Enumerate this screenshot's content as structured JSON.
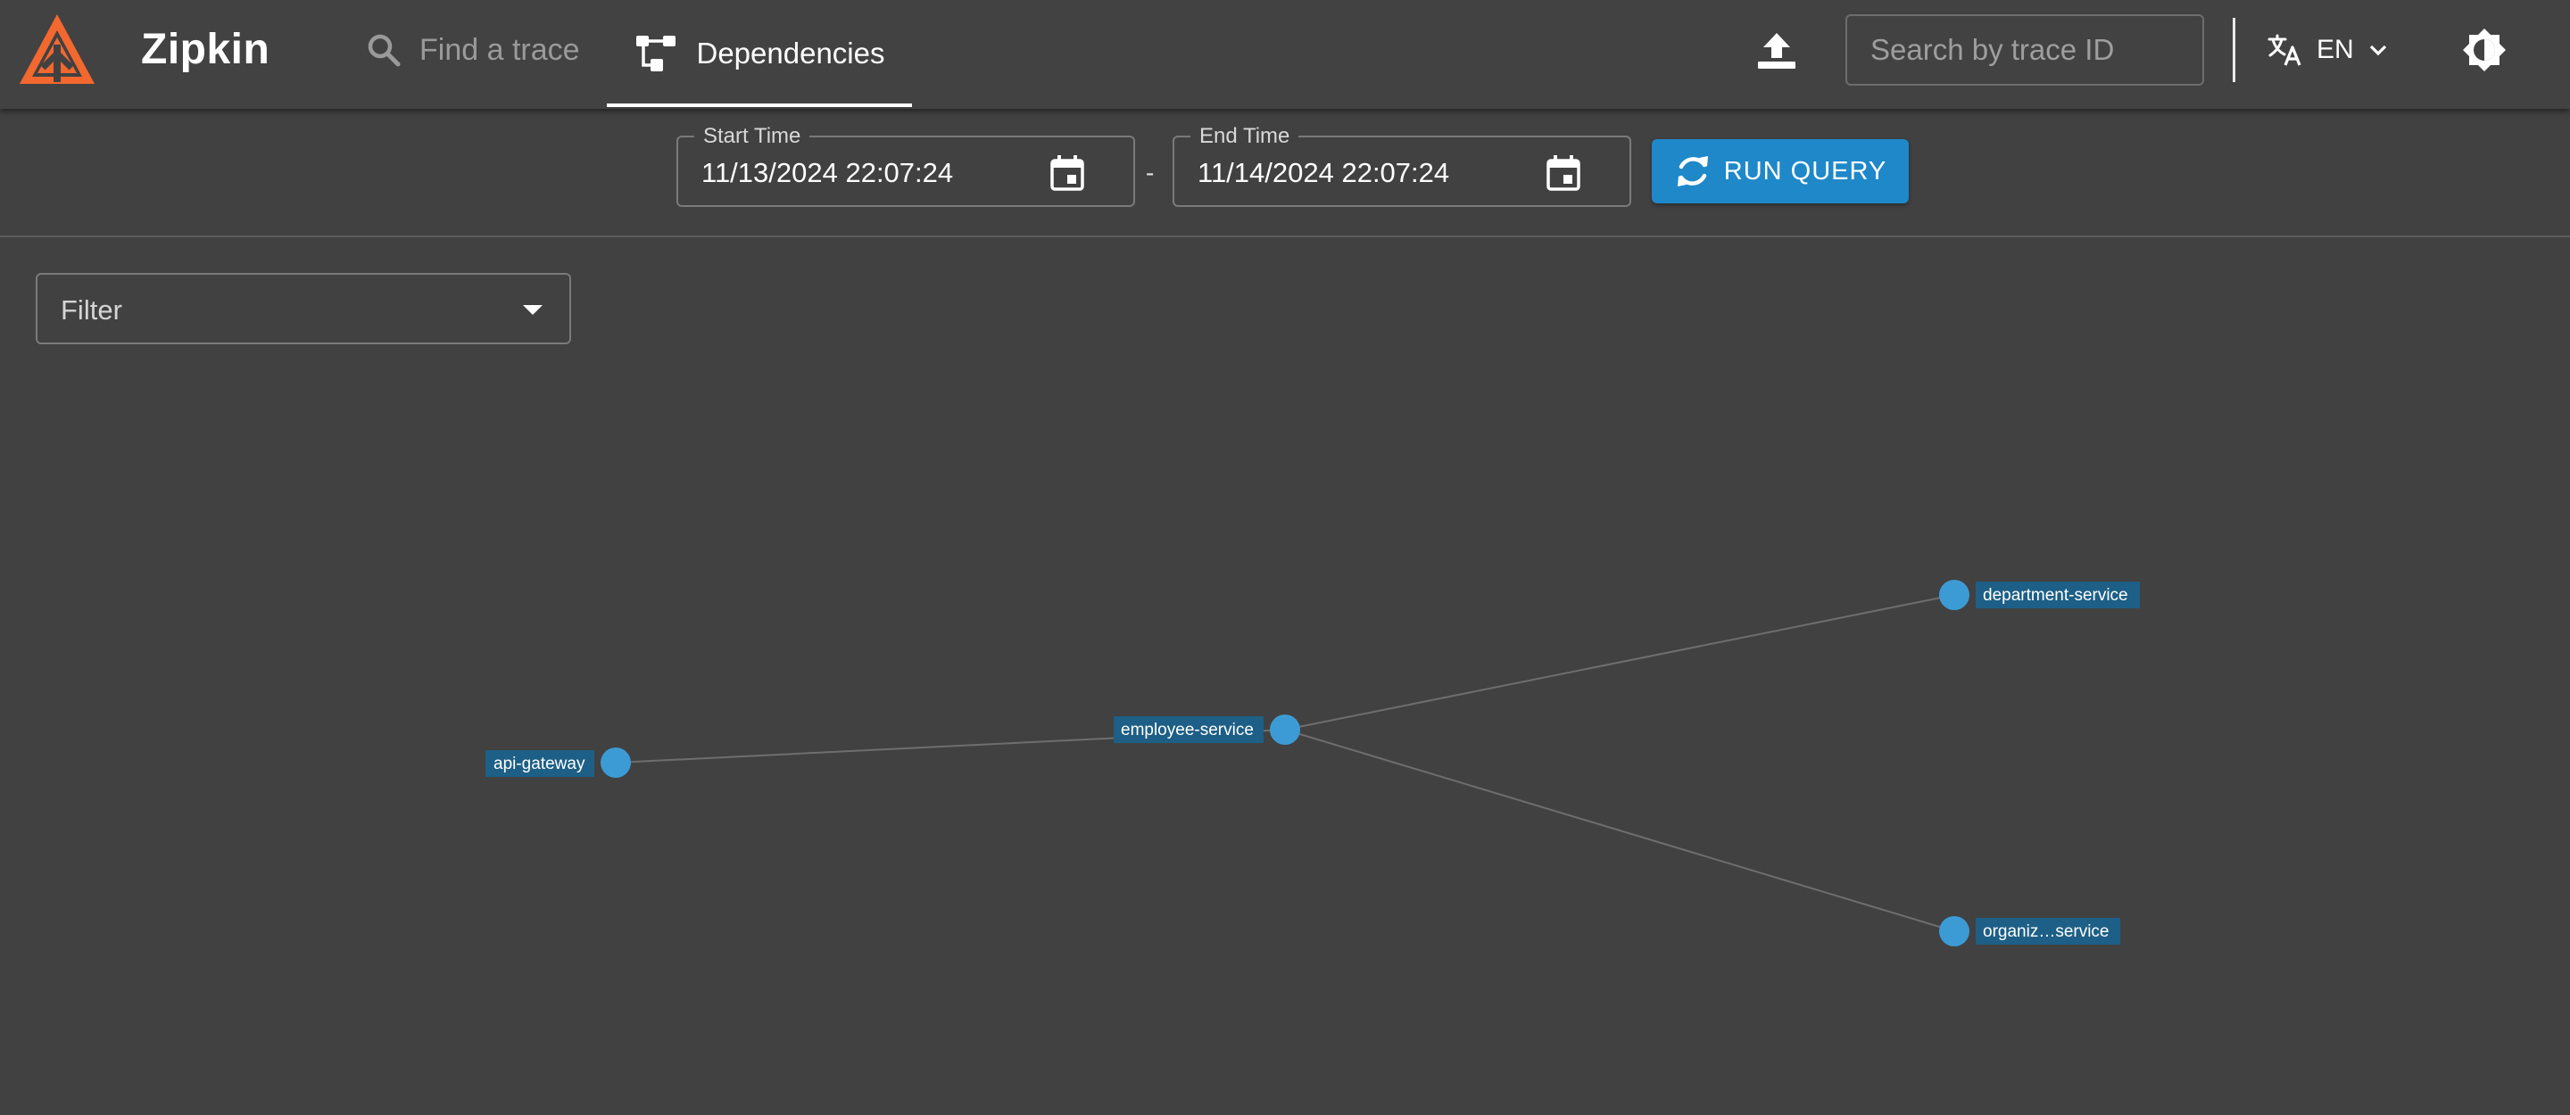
{
  "app": {
    "brand": "Zipkin"
  },
  "nav": {
    "find_trace_label": "Find a trace",
    "dependencies_label": "Dependencies"
  },
  "header": {
    "search_placeholder": "Search by trace ID",
    "language_label": "EN"
  },
  "query": {
    "start_time_label": "Start Time",
    "start_time_value": "11/13/2024 22:07:24",
    "separator": "-",
    "end_time_label": "End Time",
    "end_time_value": "11/14/2024 22:07:24",
    "run_query_label": "RUN QUERY"
  },
  "filter": {
    "placeholder": "Filter"
  },
  "dependency_graph": {
    "nodes": [
      {
        "id": "api-gateway",
        "label": "api-gateway"
      },
      {
        "id": "employee-service",
        "label": "employee-service"
      },
      {
        "id": "department-service",
        "label": "department-service"
      },
      {
        "id": "organization-service",
        "label": "organiz…service"
      }
    ],
    "edges": [
      {
        "from": "api-gateway",
        "to": "employee-service"
      },
      {
        "from": "employee-service",
        "to": "department-service"
      },
      {
        "from": "employee-service",
        "to": "organization-service"
      }
    ]
  },
  "colors": {
    "background": "#414141",
    "accent": "#1e88c9",
    "node": "#3c9bd4",
    "node_label_bg": "#1d5f86",
    "logo": "#f2682e"
  }
}
